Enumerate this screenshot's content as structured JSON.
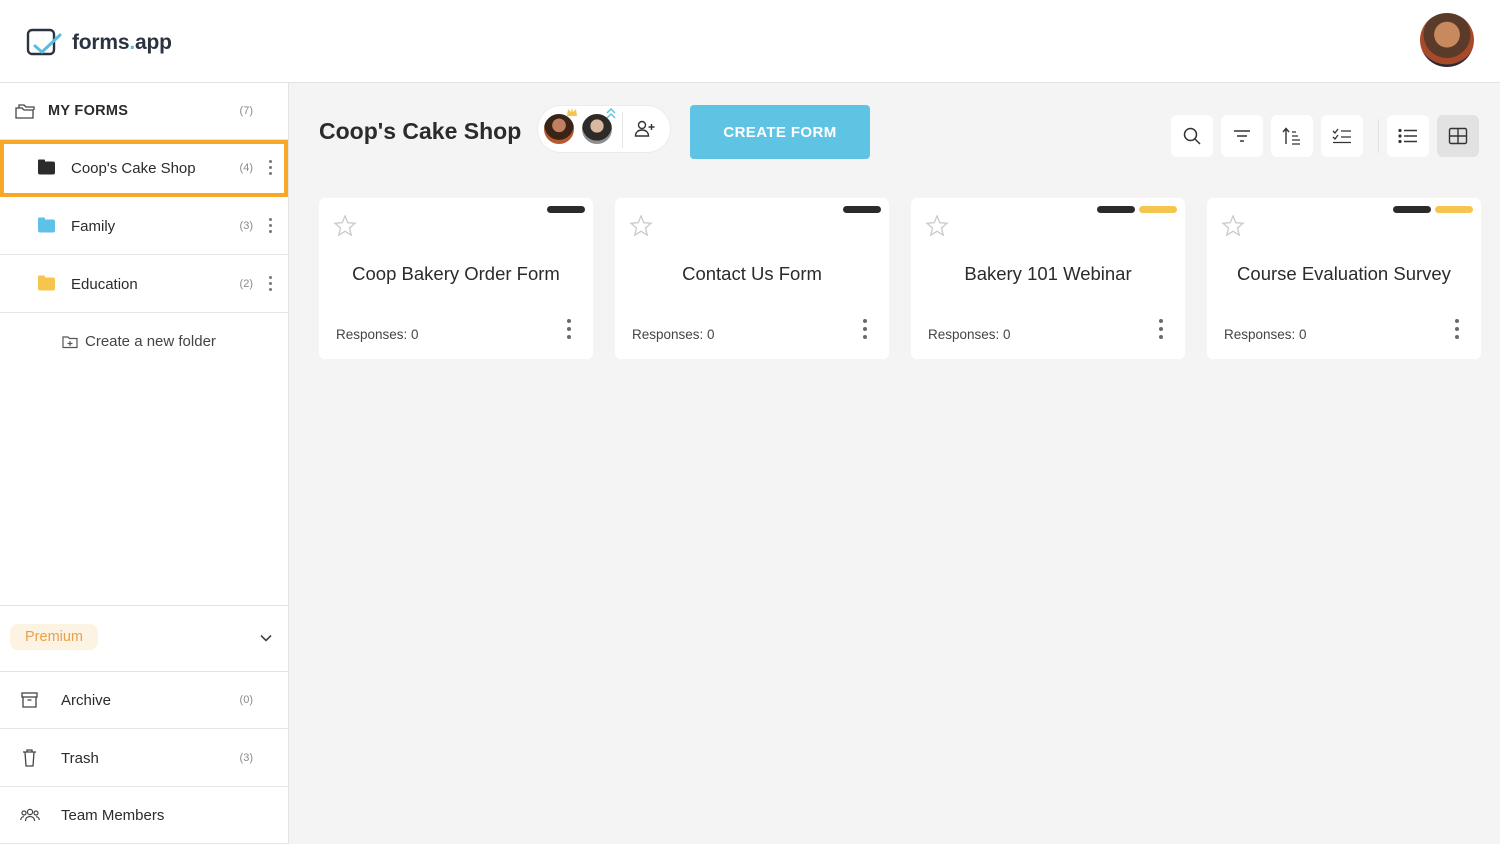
{
  "app": {
    "logo_text_a": "forms",
    "logo_text_dot": ".",
    "logo_text_b": "app"
  },
  "sidebar": {
    "my_forms": {
      "label": "MY FORMS",
      "count": "(7)"
    },
    "folders": [
      {
        "label": "Coop's Cake Shop",
        "count": "(4)",
        "color": "#2b2b2b"
      },
      {
        "label": "Family",
        "count": "(3)",
        "color": "#5ec2e6"
      },
      {
        "label": "Education",
        "count": "(2)",
        "color": "#f6c54d"
      }
    ],
    "new_folder_label": "Create a new folder",
    "premium_label": "Premium",
    "bottom": [
      {
        "label": "Archive",
        "count": "(0)"
      },
      {
        "label": "Trash",
        "count": "(3)"
      },
      {
        "label": "Team Members",
        "count": ""
      }
    ]
  },
  "main": {
    "title": "Coop's Cake Shop",
    "create_button": "CREATE FORM",
    "accent_color": "#5fc4e3",
    "cards": [
      {
        "name": "Coop Bakery Order Form",
        "responses": "Responses: 0",
        "tags": [
          "#2b2b2b"
        ]
      },
      {
        "name": "Contact Us Form",
        "responses": "Responses: 0",
        "tags": [
          "#2b2b2b"
        ]
      },
      {
        "name": "Bakery 101 Webinar",
        "responses": "Responses: 0",
        "tags": [
          "#2b2b2b",
          "#f6c54d"
        ]
      },
      {
        "name": "Course Evaluation Survey",
        "responses": "Responses: 0",
        "tags": [
          "#2b2b2b",
          "#f6c54d"
        ]
      }
    ]
  }
}
